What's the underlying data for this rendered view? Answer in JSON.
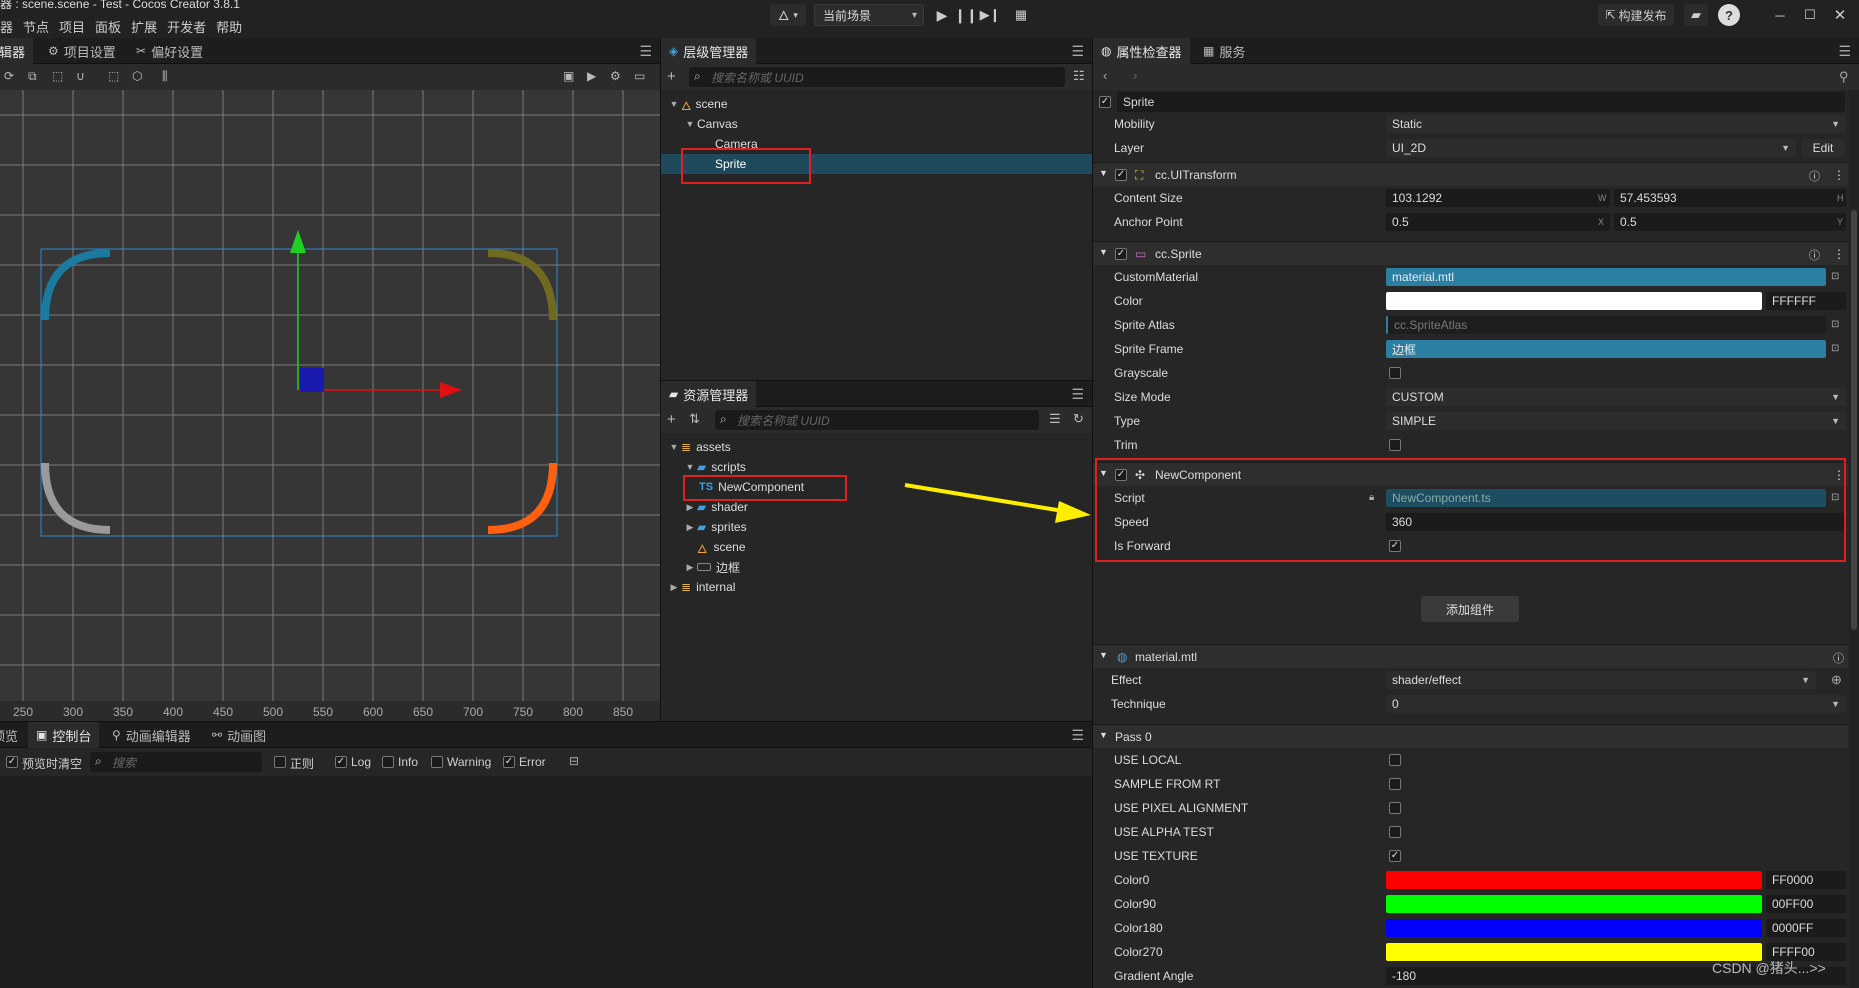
{
  "app": {
    "title": "器 : scene.scene - Test - Cocos Creator 3.8.1",
    "menu": [
      "器",
      "节点",
      "项目",
      "面板",
      "扩展",
      "开发者",
      "帮助"
    ],
    "scene_select": "当前场景",
    "publish": "构建发布"
  },
  "scene_panel": {
    "tabs": [
      "编辑器",
      "项目设置",
      "偏好设置"
    ],
    "ruler": [
      "250",
      "300",
      "350",
      "400",
      "450",
      "500",
      "550",
      "600",
      "650",
      "700",
      "750",
      "800",
      "850"
    ]
  },
  "hierarchy": {
    "tab": "层级管理器",
    "search_placeholder": "搜索名称或 UUID",
    "rows": [
      "scene",
      "Canvas",
      "Camera",
      "Sprite"
    ]
  },
  "assets": {
    "tab": "资源管理器",
    "search_placeholder": "搜索名称或 UUID",
    "rows": [
      "assets",
      "scripts",
      "NewComponent",
      "shader",
      "sprites",
      "scene",
      "边框",
      "internal"
    ],
    "ts_badge": "TS"
  },
  "console": {
    "tabs": [
      "预览",
      "控制台",
      "动画编辑器",
      "动画图"
    ],
    "clear_on_preview": "预览时清空",
    "search_placeholder": "搜索",
    "filters": [
      "正则",
      "Log",
      "Info",
      "Warning",
      "Error"
    ]
  },
  "inspector": {
    "tabs": [
      "属性检查器",
      "服务"
    ],
    "node_name": "Sprite",
    "mobility_label": "Mobility",
    "mobility": "Static",
    "layer_label": "Layer",
    "layer": "UI_2D",
    "edit": "Edit",
    "uitransform": {
      "title": "cc.UITransform",
      "content_size_label": "Content Size",
      "w": "103.1292",
      "h": "57.453593",
      "anchor_label": "Anchor Point",
      "ax": "0.5",
      "ay": "0.5",
      "w_hint": "W",
      "h_hint": "H",
      "x_hint": "X",
      "y_hint": "Y"
    },
    "sprite": {
      "title": "cc.Sprite",
      "custom_material_label": "CustomMaterial",
      "custom_material": "material.mtl",
      "color_label": "Color",
      "color_hex": "FFFFFF",
      "atlas_label": "Sprite Atlas",
      "atlas": "cc.SpriteAtlas",
      "frame_label": "Sprite Frame",
      "frame": "边框",
      "grayscale_label": "Grayscale",
      "size_mode_label": "Size Mode",
      "size_mode": "CUSTOM",
      "type_label": "Type",
      "type": "SIMPLE",
      "trim_label": "Trim"
    },
    "newcomp": {
      "title": "NewComponent",
      "script_label": "Script",
      "script": "NewComponent.ts",
      "speed_label": "Speed",
      "speed": "360",
      "forward_label": "Is Forward"
    },
    "add_component": "添加组件",
    "material": {
      "title": "material.mtl",
      "effect_label": "Effect",
      "effect": "shader/effect",
      "technique_label": "Technique",
      "technique": "0",
      "pass": "Pass 0",
      "defines": [
        "USE LOCAL",
        "SAMPLE FROM RT",
        "USE PIXEL ALIGNMENT",
        "USE ALPHA TEST",
        "USE TEXTURE"
      ],
      "colors": [
        {
          "label": "Color0",
          "hex": "FF0000",
          "color": "#ff0000"
        },
        {
          "label": "Color90",
          "hex": "00FF00",
          "color": "#00ff00"
        },
        {
          "label": "Color180",
          "hex": "0000FF",
          "color": "#0000ff"
        },
        {
          "label": "Color270",
          "hex": "FFFF00",
          "color": "#ffff00"
        }
      ],
      "gradient_label": "Gradient Angle",
      "gradient": "-180"
    }
  },
  "watermark": "CSDN @猪头...>>",
  "colors": {
    "accent": "#2a7fa3",
    "selection": "#1f4a5e",
    "annotation": "#e02020",
    "arrow": "#ffee00"
  }
}
